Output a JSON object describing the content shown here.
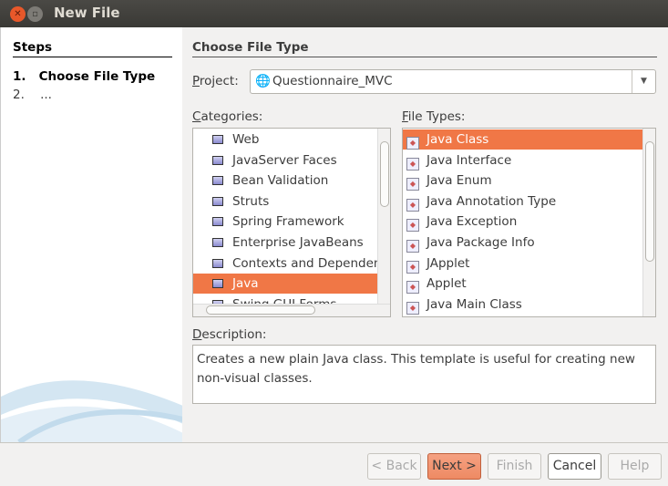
{
  "window": {
    "title": "New File"
  },
  "steps": {
    "heading": "Steps",
    "items": [
      {
        "num": "1.",
        "label": "Choose File Type",
        "current": true
      },
      {
        "num": "2.",
        "label": "...",
        "current": false
      }
    ]
  },
  "main": {
    "heading": "Choose File Type",
    "project": {
      "label": "Project:",
      "value": "Questionnaire_MVC"
    },
    "categories": {
      "label": "Categories:",
      "items": [
        "Web",
        "JavaServer Faces",
        "Bean Validation",
        "Struts",
        "Spring Framework",
        "Enterprise JavaBeans",
        "Contexts and Dependency Injection",
        "Java",
        "Swing GUI Forms"
      ],
      "selected": "Java"
    },
    "file_types": {
      "label": "File Types:",
      "items": [
        "Java Class",
        "Java Interface",
        "Java Enum",
        "Java Annotation Type",
        "Java Exception",
        "Java Package Info",
        "JApplet",
        "Applet",
        "Java Main Class"
      ],
      "selected": "Java Class"
    },
    "description": {
      "label": "Description:",
      "text": "Creates a new plain Java class. This template is useful for creating new non-visual classes."
    }
  },
  "buttons": {
    "back": "< Back",
    "next": "Next >",
    "finish": "Finish",
    "cancel": "Cancel",
    "help": "Help"
  },
  "colors": {
    "accent": "#f07746",
    "titlebar": "#3c3b37"
  }
}
